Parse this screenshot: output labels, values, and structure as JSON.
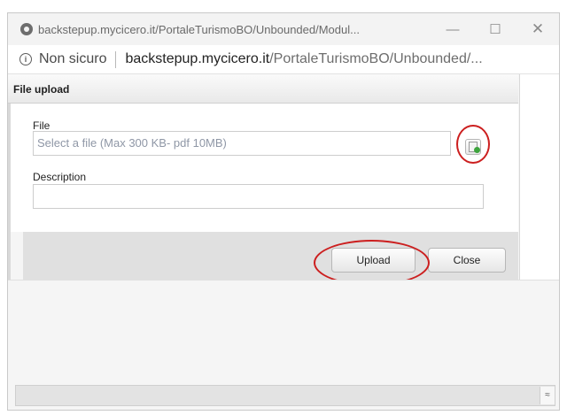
{
  "window": {
    "title": "backstepup.mycicero.it/PortaleTurismoBO/Unbounded/Modul...",
    "minimize_glyph": "—",
    "maximize_glyph": "☐",
    "close_glyph": "✕"
  },
  "address": {
    "security_label": "Non sicuro",
    "url_host": "backstepup.mycicero.it",
    "url_path": "/PortaleTurismoBO/Unbounded/..."
  },
  "dialog": {
    "title": "File upload",
    "file_label": "File",
    "file_placeholder": "Select a file (Max 300 KB- pdf 10MB)",
    "description_label": "Description",
    "description_value": "",
    "upload_label": "Upload",
    "close_label": "Close"
  },
  "status": {
    "scroll_glyph": "≈"
  },
  "colors": {
    "annotation_red": "#cc1f1f",
    "browse_plus_green": "#3ea43e"
  }
}
